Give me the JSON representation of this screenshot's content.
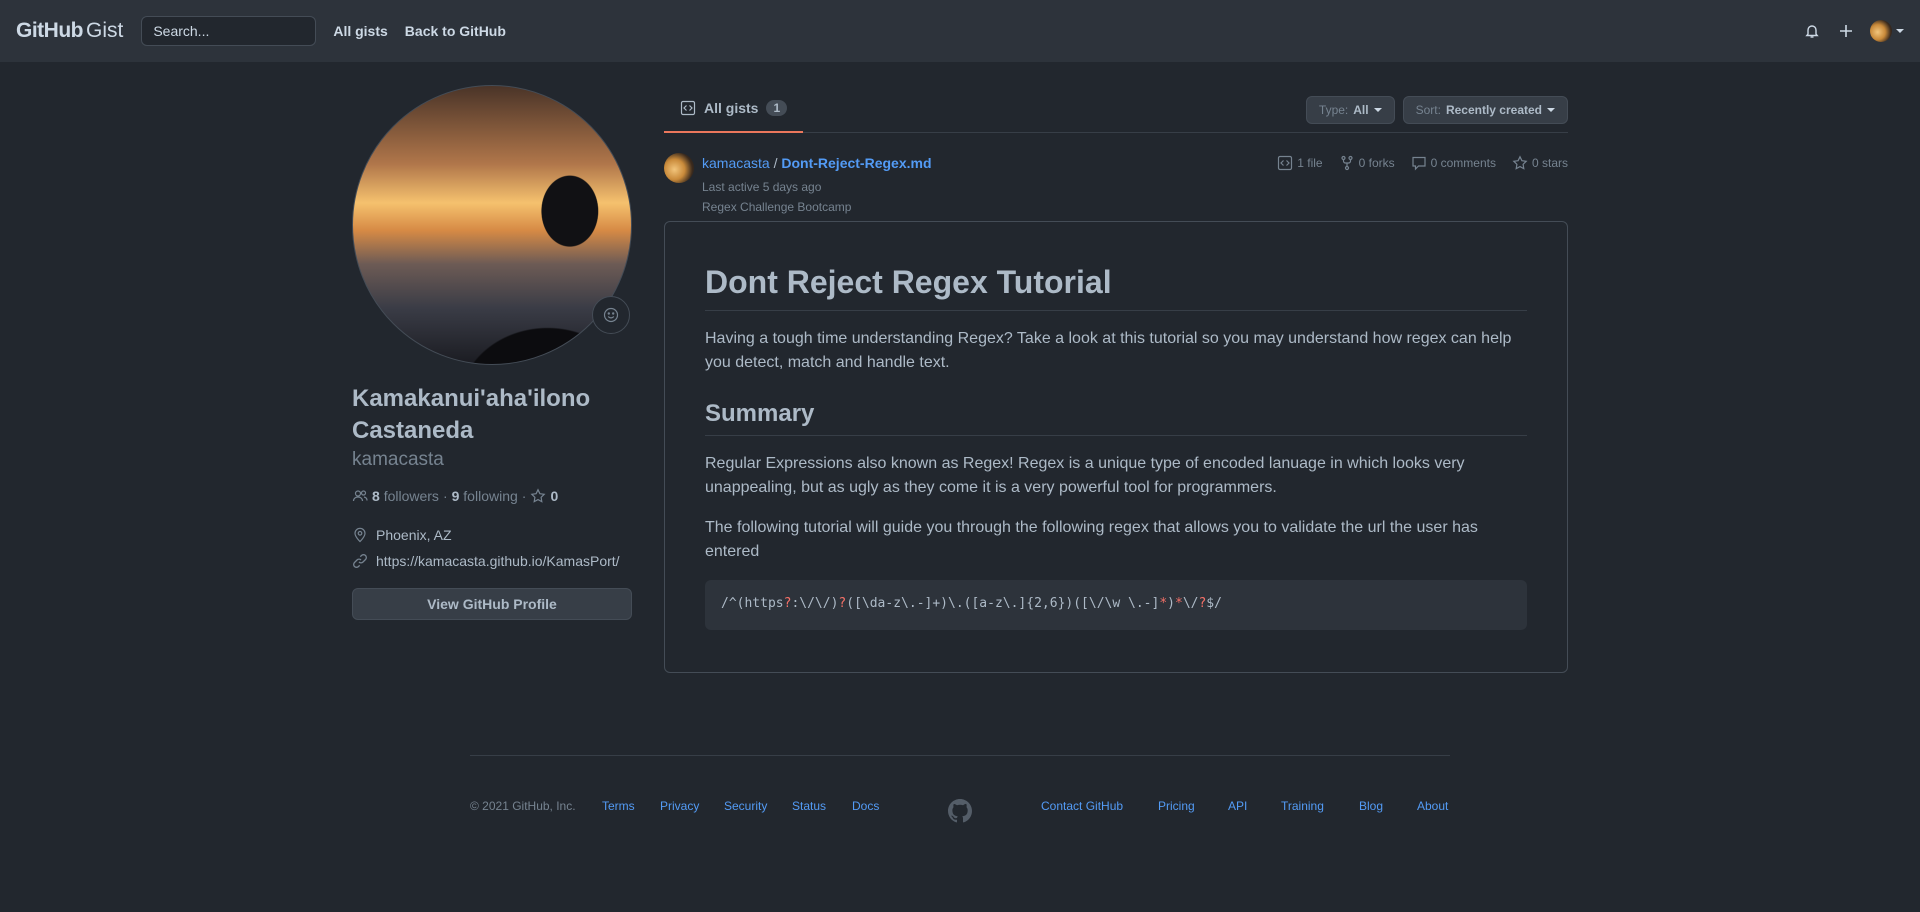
{
  "header": {
    "logo_primary": "GitHub",
    "logo_secondary": "Gist",
    "search_placeholder": "Search...",
    "nav": [
      "All gists",
      "Back to GitHub"
    ]
  },
  "profile": {
    "full_name": "Kamakanui'aha'ilono Castaneda",
    "username": "kamacasta",
    "followers_count": "8",
    "followers_label": "followers",
    "following_count": "9",
    "following_label": "following",
    "stars_count": "0",
    "location": "Phoenix, AZ",
    "website": "https://kamacasta.github.io/KamasPort/",
    "view_profile_label": "View GitHub Profile"
  },
  "tabs": {
    "all_gists_label": "All gists",
    "all_gists_count": "1",
    "type_label": "Type:",
    "type_value": "All",
    "sort_label": "Sort:",
    "sort_value": "Recently created"
  },
  "gist": {
    "owner": "kamacasta",
    "separator": "/",
    "filename": "Dont-Reject-Regex.md",
    "last_active": "Last active 5 days ago",
    "description": "Regex Challenge Bootcamp",
    "files": "1 file",
    "forks": "0 forks",
    "comments": "0 comments",
    "stars": "0 stars"
  },
  "readme": {
    "title": "Dont Reject Regex Tutorial",
    "intro": "Having a tough time understanding Regex? Take a look at this tutorial so you may understand how regex can help you detect, match and handle text.",
    "summary_heading": "Summary",
    "summary_p1": "Regular Expressions also known as Regex! Regex is a unique type of encoded lanuage in which looks very unappealing, but as ugly as they come it is a very powerful tool for programmers.",
    "summary_p2": "The following tutorial will guide you through the following regex that allows you to validate the url the user has entered",
    "code": {
      "p1": "/^(https",
      "q1": "?",
      "p2": ":\\/\\/)",
      "q2": "?",
      "p3": "([\\da-z\\.-]+)\\.([a-z\\.]{2,6})([\\/\\w \\.-]",
      "s1": "*",
      "p4": ")",
      "s2": "*",
      "p5": "\\/",
      "q3": "?",
      "p6": "$/"
    }
  },
  "footer": {
    "copyright": "© 2021 GitHub, Inc.",
    "left_links": [
      "Terms",
      "Privacy",
      "Security",
      "Status",
      "Docs"
    ],
    "right_links": [
      "Contact GitHub",
      "Pricing",
      "API",
      "Training",
      "Blog",
      "About"
    ]
  },
  "colors": {
    "background": "#22272e",
    "header": "#2d333b",
    "link": "#539bf5",
    "tab_underline": "#ec775c"
  }
}
